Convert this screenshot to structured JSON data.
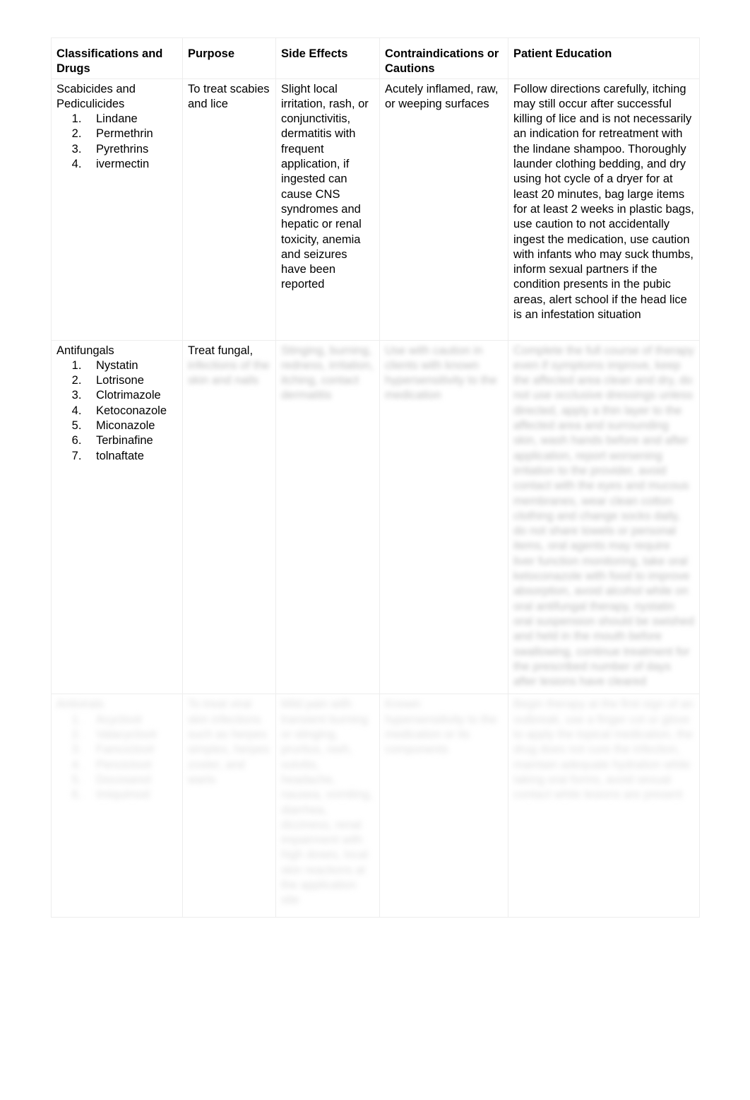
{
  "document": {
    "type": "pharmacology-reference-table",
    "page_background": "#ffffff",
    "border_color": "#ededed"
  },
  "table": {
    "headers": [
      "Classifications and Drugs",
      "Purpose",
      "Side Effects",
      "Contraindications or Cautions",
      "Patient Education"
    ],
    "rows": [
      {
        "legible": true,
        "classification": "Scabicides and Pediculicides",
        "drugs": [
          "Lindane",
          "Permethrin",
          "Pyrethrins",
          "ivermectin"
        ],
        "purpose": "To treat scabies and lice",
        "side_effects": "Slight local irritation, rash, or conjunctivitis, dermatitis with frequent application, if ingested can cause CNS syndromes and hepatic or renal toxicity, anemia and seizures have been reported",
        "contraindications": "Acutely inflamed, raw, or weeping surfaces",
        "patient_education": "Follow directions carefully, itching may still occur after successful killing of lice and is not necessarily an indication for retreatment with the lindane shampoo. Thoroughly launder clothing bedding, and dry using hot cycle of a dryer for at least 20 minutes, bag large items for at least 2 weeks in plastic bags, use caution to not accidentally ingest the medication, use caution with infants who may suck thumbs, inform sexual partners if the condition presents in the pubic areas, alert school if the head lice is an infestation situation"
      },
      {
        "legible": "partial",
        "classification": "Antifungals",
        "drugs": [
          "Nystatin",
          "Lotrisone",
          "Clotrimazole",
          "Ketoconazole",
          "Miconazole",
          "Terbinafine",
          "tolnaftate"
        ],
        "purpose_visible": "Treat fungal,",
        "purpose_blurred": "infections of the skin and nails",
        "side_effects_blurred": "Stinging, burning, redness, irritation, itching, contact dermatitis",
        "contraindications_blurred": "Use with caution in clients with known hypersensitivity to the medication",
        "patient_education_blurred": "Complete the full course of therapy even if symptoms improve, keep the affected area clean and dry, do not use occlusive dressings unless directed, apply a thin layer to the affected area and surrounding skin, wash hands before and after application, report worsening irritation to the provider, avoid contact with the eyes and mucous membranes, wear clean cotton clothing and change socks daily, do not share towels or personal items, oral agents may require liver function monitoring, take oral ketoconazole with food to improve absorption, avoid alcohol while on oral antifungal therapy, nystatin oral suspension should be swished and held in the mouth before swallowing, continue treatment for the prescribed number of days after lesions have cleared"
      },
      {
        "legible": false,
        "classification_blurred": "Antivirals",
        "drugs_blurred": [
          "Acyclovir",
          "Valacyclovir",
          "Famciclovir",
          "Penciclovir",
          "Docosanol",
          "Imiquimod"
        ],
        "purpose_blurred": "To treat viral skin infections such as herpes simplex, herpes zoster, and warts",
        "side_effects_blurred": "Mild pain with transient burning or stinging, pruritus, rash, vulvitis, headache, nausea, vomiting, diarrhea, dizziness, renal impairment with high doses, local skin reactions at the application site",
        "contraindications_blurred": "Known hypersensitivity to the medication or its components",
        "patient_education_blurred": "Begin therapy at the first sign of an outbreak, use a finger cot or glove to apply the topical medication, the drug does not cure the infection, maintain adequate hydration while taking oral forms, avoid sexual contact while lesions are present"
      }
    ]
  }
}
